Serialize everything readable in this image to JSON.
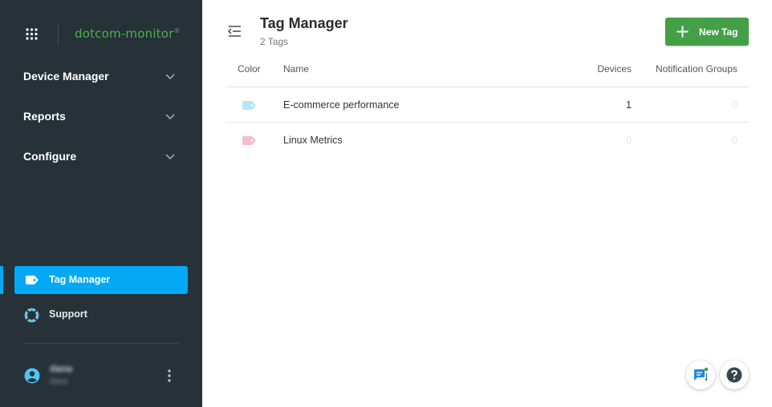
{
  "brand": {
    "logo_text": "dotcom-monitor",
    "reg_mark": "®"
  },
  "sidebar": {
    "nav": [
      {
        "label": "Device Manager",
        "icon": "chevron-down-icon"
      },
      {
        "label": "Reports",
        "icon": "chevron-down-icon"
      },
      {
        "label": "Configure",
        "icon": "chevron-down-icon"
      }
    ],
    "tag_manager": {
      "label": "Tag Manager",
      "icon": "tag-icon",
      "active": true
    },
    "support": {
      "label": "Support",
      "icon": "lifebuoy-icon"
    },
    "user": {
      "name": "dana",
      "subtitle": "dana"
    }
  },
  "header": {
    "title": "Tag Manager",
    "subtitle": "2 Tags",
    "new_tag_label": "New Tag"
  },
  "table": {
    "columns": {
      "color": "Color",
      "name": "Name",
      "devices": "Devices",
      "groups": "Notification Groups"
    },
    "rows": [
      {
        "color": "#b3e5fc",
        "name": "E-commerce performance",
        "devices": "1",
        "groups": "0"
      },
      {
        "color": "#f8bbd0",
        "name": "Linux Metrics",
        "devices": "0",
        "groups": "0"
      }
    ]
  },
  "colors": {
    "sidebar_bg": "#263238",
    "accent": "#03a9f4",
    "primary_button": "#43a047",
    "brand_green": "#4caf50"
  },
  "fabs": {
    "chat_icon": "chat-icon",
    "help_icon": "help-icon"
  }
}
